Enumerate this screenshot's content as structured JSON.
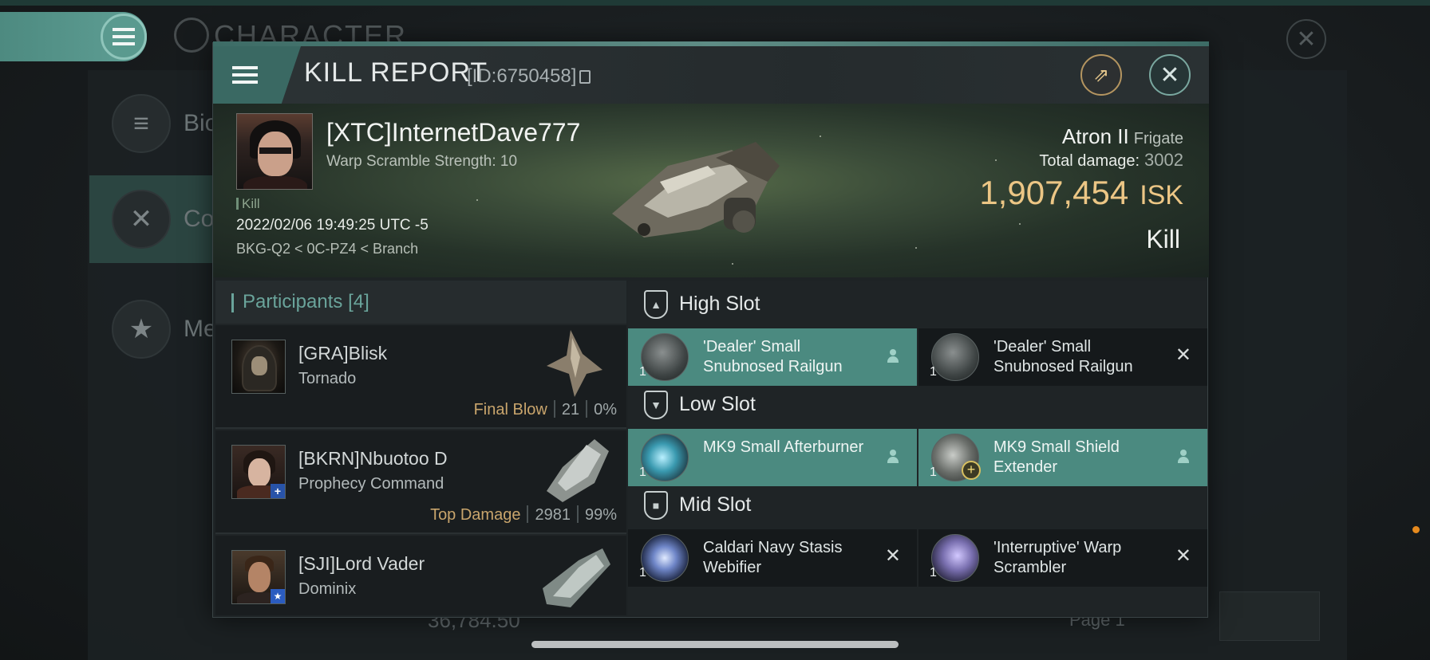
{
  "background": {
    "screen_title": "CHARACTER",
    "nav": [
      {
        "label": "Bio",
        "icon": "menu-icon"
      },
      {
        "label": "Co",
        "icon": "crossed-swords-icon"
      },
      {
        "label": "Me",
        "icon": "star-icon"
      }
    ],
    "bottom_value": "36,784.50",
    "page_label": "Page 1"
  },
  "dialog": {
    "title": "KILL REPORT",
    "report_id": "[ID:6750458]"
  },
  "victim": {
    "name": "[XTC]InternetDave777",
    "warp_scramble": "Warp Scramble Strength: 10",
    "tag": "Kill",
    "timestamp": "2022/02/06 19:49:25 UTC -5",
    "location": "BKG-Q2 < 0C-PZ4 < Branch",
    "ship_name": "Atron II",
    "ship_class": "Frigate",
    "total_damage_label": "Total damage:",
    "total_damage": "3002",
    "isk_value": "1,907,454",
    "isk_unit": "ISK",
    "result": "Kill"
  },
  "participants": {
    "label": "Participants",
    "count": "[4]",
    "items": [
      {
        "name": "[GRA]Blisk",
        "ship": "Tornado",
        "role": "Final Blow",
        "damage": "21",
        "percent": "0%"
      },
      {
        "name": "[BKRN]Nbuotoo D",
        "ship": "Prophecy Command",
        "role": "Top Damage",
        "damage": "2981",
        "percent": "99%"
      },
      {
        "name": "[SJI]Lord Vader",
        "ship": "Dominix",
        "role": "",
        "damage": "",
        "percent": ""
      }
    ]
  },
  "fitting": {
    "high": {
      "label": "High Slot",
      "modules": [
        {
          "name": "'Dealer' Small Snubnosed Railgun",
          "qty": "1"
        },
        {
          "name": "'Dealer' Small Snubnosed Railgun",
          "qty": "1"
        }
      ]
    },
    "low": {
      "label": "Low Slot",
      "modules": [
        {
          "name": "MK9 Small Afterburner",
          "qty": "1"
        },
        {
          "name": "MK9 Small Shield Extender",
          "qty": "1"
        }
      ]
    },
    "mid": {
      "label": "Mid Slot",
      "modules": [
        {
          "name": "Caldari Navy Stasis Webifier",
          "qty": "1"
        },
        {
          "name": "'Interruptive' Warp Scrambler",
          "qty": "1"
        }
      ]
    }
  },
  "colors": {
    "accent": "#4b8a80",
    "isk": "#ecc685",
    "final_blow": "#c9a56c"
  }
}
